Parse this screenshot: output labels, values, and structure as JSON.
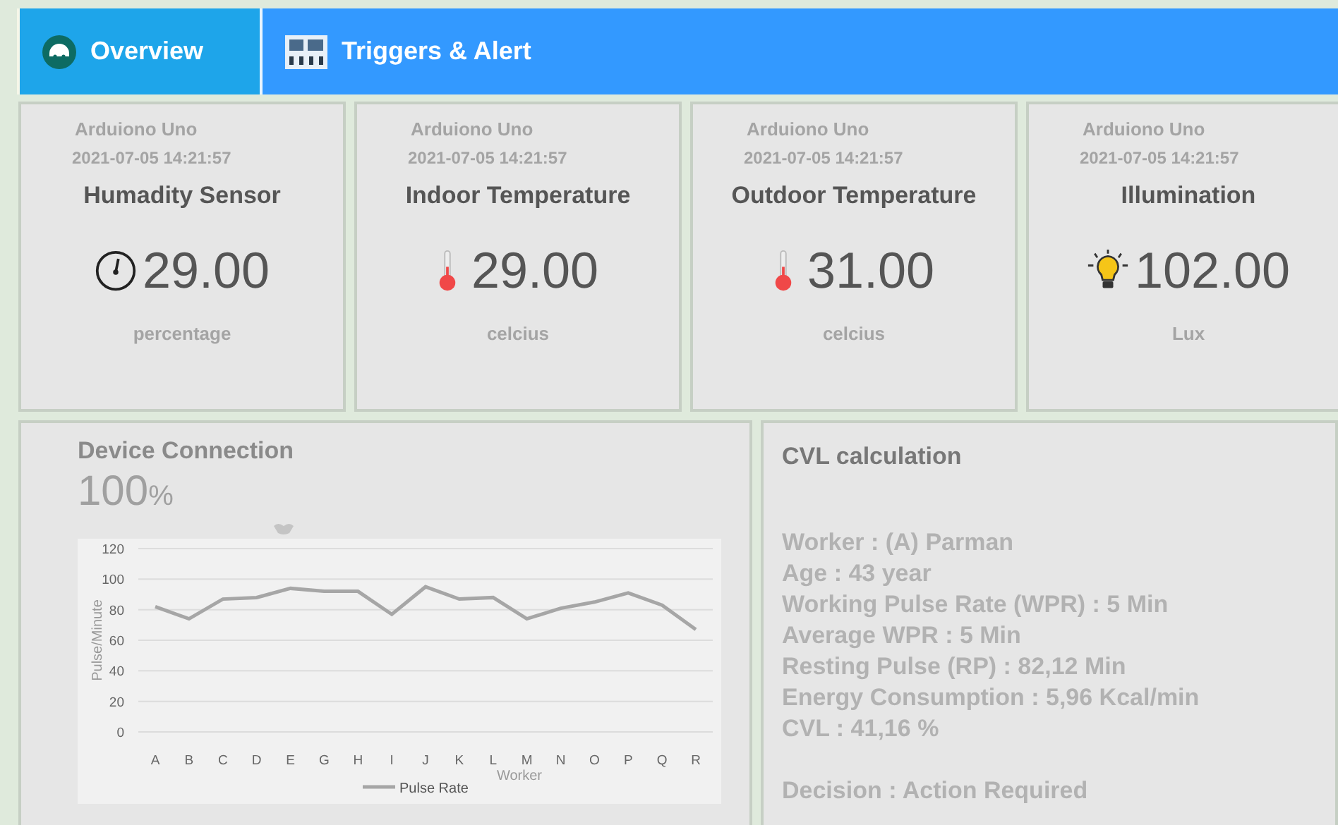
{
  "tabs": [
    {
      "label": "Overview",
      "selected": true
    },
    {
      "label": "Triggers & Alert",
      "selected": false
    }
  ],
  "sensors": [
    {
      "device": "Arduiono Uno",
      "timestamp": "2021-07-05 14:21:57",
      "title": "Humadity Sensor",
      "value": "29.00",
      "unit": "percentage"
    },
    {
      "device": "Arduiono Uno",
      "timestamp": "2021-07-05 14:21:57",
      "title": "Indoor Temperature",
      "value": "29.00",
      "unit": "celcius"
    },
    {
      "device": "Arduiono Uno",
      "timestamp": "2021-07-05 14:21:57",
      "title": "Outdoor Temperature",
      "value": "31.00",
      "unit": "celcius"
    },
    {
      "device": "Arduiono Uno",
      "timestamp": "2021-07-05 14:21:57",
      "title": "Illumination",
      "value": "102.00",
      "unit": "Lux"
    }
  ],
  "device_connection": {
    "title": "Device Connection",
    "value": "100",
    "unit": "%",
    "chart_data": {
      "type": "line",
      "xlabel": "Worker",
      "ylabel": "Pulse/Minute",
      "categories": [
        "A",
        "B",
        "C",
        "D",
        "E",
        "G",
        "H",
        "I",
        "J",
        "K",
        "L",
        "M",
        "N",
        "O",
        "P",
        "Q",
        "R"
      ],
      "series": [
        {
          "name": "Pulse Rate",
          "color": "#a6a6a6",
          "values": [
            82,
            74,
            87,
            88,
            94,
            92,
            92,
            77,
            95,
            87,
            88,
            74,
            81,
            85,
            91,
            83,
            67
          ]
        }
      ],
      "ylim": [
        0,
        120
      ],
      "grid": true,
      "yticks": [
        0,
        20,
        40,
        60,
        80,
        100,
        120
      ]
    }
  },
  "cvl": {
    "title": "CVL calculation",
    "lines": [
      "Worker : (A) Parman",
      "Age : 43 year",
      "Working Pulse Rate (WPR) : 5 Min",
      "Average WPR : 5 Min",
      "Resting Pulse (RP) : 82,12 Min",
      "Energy Consumption : 5,96 Kcal/min",
      "CVL : 41,16 %"
    ],
    "decision": "Decision : Action Required"
  }
}
